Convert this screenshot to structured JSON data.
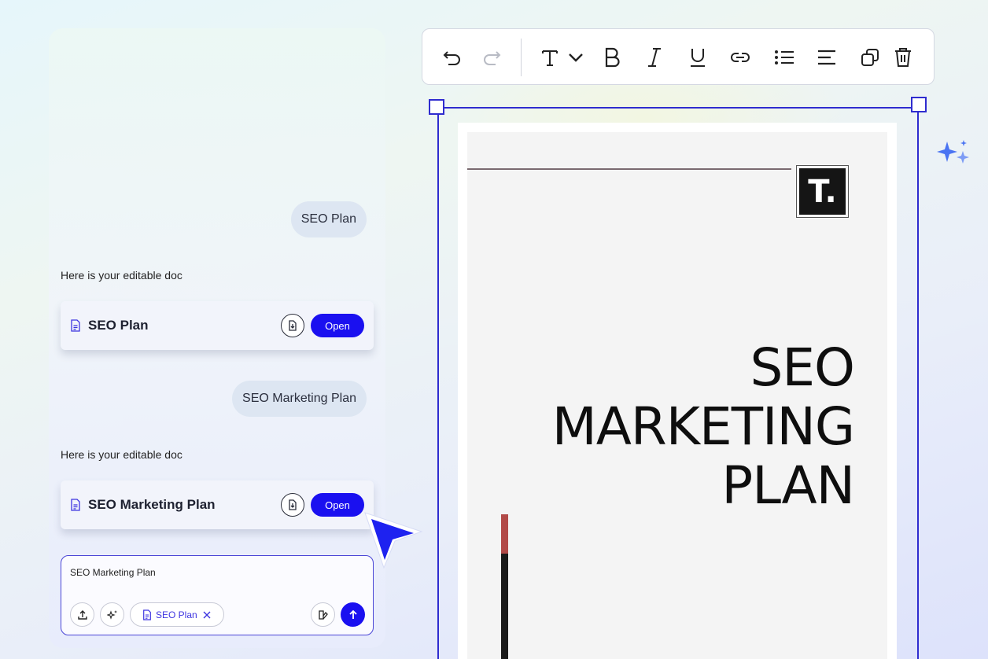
{
  "chat": {
    "messages": [
      {
        "role": "user",
        "text": "SEO Plan"
      },
      {
        "role": "bot",
        "text": "Here is your editable doc"
      },
      {
        "role": "user",
        "text": "SEO Marketing Plan"
      },
      {
        "role": "bot",
        "text": "Here is your editable doc"
      }
    ],
    "doc_cards": [
      {
        "title": "SEO Plan",
        "open_label": "Open",
        "icon": "document-icon",
        "action_icon": "download-icon"
      },
      {
        "title": "SEO Marketing Plan",
        "open_label": "Open",
        "icon": "document-icon",
        "action_icon": "download-icon"
      }
    ],
    "input": {
      "value": "SEO Marketing Plan",
      "attachment_chip": "SEO Plan",
      "buttons": [
        "upload-icon",
        "magic-sparkle-icon",
        "template-icon",
        "send-arrow-icon"
      ]
    }
  },
  "toolbar": {
    "items": [
      "undo-icon",
      "redo-icon",
      "text-style-icon",
      "chevron-down-icon",
      "bold-icon",
      "italic-icon",
      "underline-icon",
      "link-icon",
      "bullet-list-icon",
      "align-left-icon",
      "duplicate-icon",
      "delete-icon"
    ]
  },
  "document": {
    "logo_text": "T.",
    "title_lines": [
      "SEO",
      "MARKETING",
      "PLAN"
    ]
  },
  "colors": {
    "accent": "#1a10f0",
    "selection": "#2f2ccf",
    "bar_red": "#b24a48",
    "bar_black": "#1a1a1a"
  }
}
